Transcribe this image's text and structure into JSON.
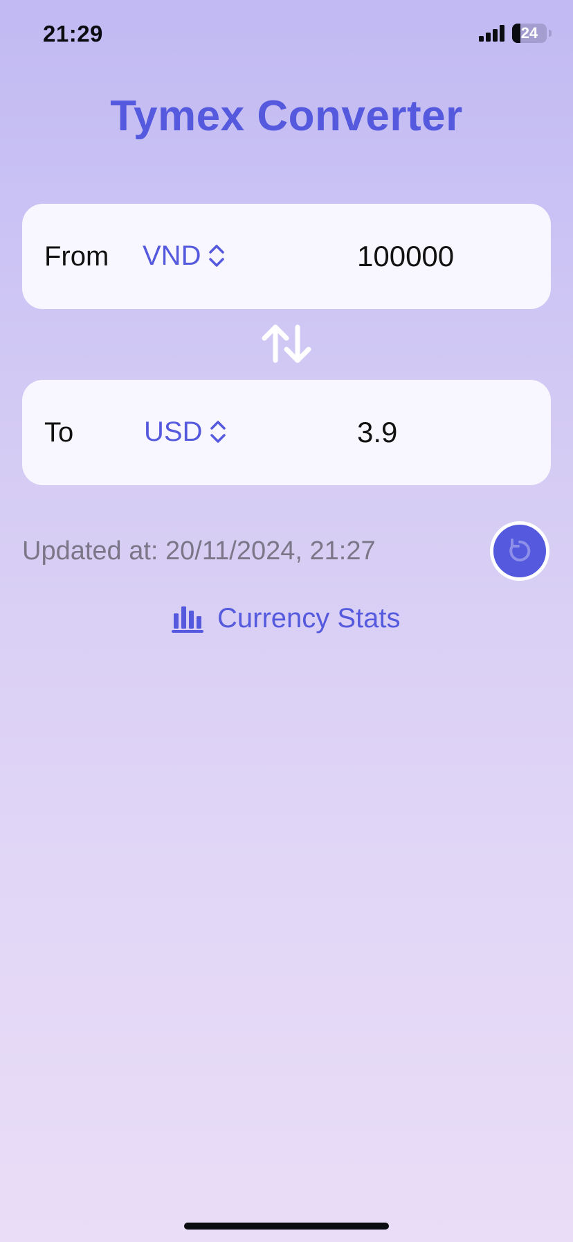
{
  "status_bar": {
    "time": "21:29",
    "battery_level": "24",
    "battery_fraction": 0.24,
    "signal_icon": "cellular-signal-icon"
  },
  "app": {
    "title": "Tymex Converter"
  },
  "from_card": {
    "label": "From",
    "currency": "VND",
    "amount": "100000",
    "picker_icon": "chevron-updown-icon"
  },
  "swap": {
    "icon": "swap-arrows-icon"
  },
  "to_card": {
    "label": "To",
    "currency": "USD",
    "amount": "3.9",
    "picker_icon": "chevron-updown-icon"
  },
  "updated": {
    "text": "Updated at: 20/11/2024, 21:27"
  },
  "refresh": {
    "icon": "refresh-icon"
  },
  "stats": {
    "label": "Currency Stats",
    "icon": "bar-chart-icon"
  },
  "colors": {
    "accent": "#5459dd",
    "card_background": "#f8f6fe",
    "muted_text": "#7c7788",
    "background_top": "#c1baf3",
    "background_bottom": "#e9ddf7"
  }
}
